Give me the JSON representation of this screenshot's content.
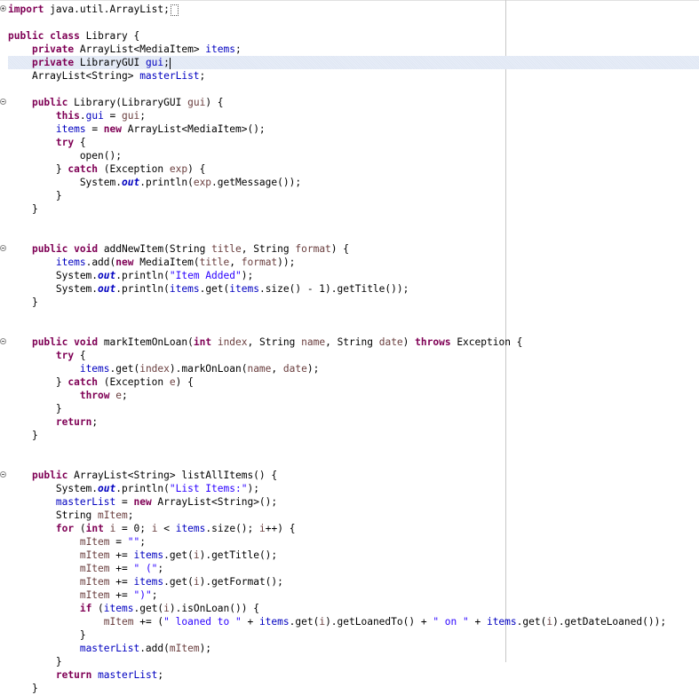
{
  "editor": {
    "language": "java",
    "lines": [
      [
        {
          "t": "import",
          "c": "k"
        },
        {
          "t": " java.util.ArrayList;"
        }
      ],
      [],
      [
        {
          "t": "public",
          "c": "k"
        },
        {
          "t": " "
        },
        {
          "t": "class",
          "c": "k"
        },
        {
          "t": " Library {"
        }
      ],
      [
        {
          "t": "    "
        },
        {
          "t": "private",
          "c": "k"
        },
        {
          "t": " ArrayList<MediaItem> "
        },
        {
          "t": "items",
          "c": "f"
        },
        {
          "t": ";"
        }
      ],
      [
        {
          "t": "    "
        },
        {
          "t": "private",
          "c": "k"
        },
        {
          "t": " LibraryGUI "
        },
        {
          "t": "gui",
          "c": "f"
        },
        {
          "t": ";"
        }
      ],
      [
        {
          "t": "    ArrayList<String> "
        },
        {
          "t": "masterList",
          "c": "f"
        },
        {
          "t": ";"
        }
      ],
      [],
      [
        {
          "t": "    "
        },
        {
          "t": "public",
          "c": "k"
        },
        {
          "t": " Library(LibraryGUI "
        },
        {
          "t": "gui",
          "c": "p"
        },
        {
          "t": ") {"
        }
      ],
      [
        {
          "t": "        "
        },
        {
          "t": "this",
          "c": "k"
        },
        {
          "t": "."
        },
        {
          "t": "gui",
          "c": "f"
        },
        {
          "t": " = "
        },
        {
          "t": "gui",
          "c": "p"
        },
        {
          "t": ";"
        }
      ],
      [
        {
          "t": "        "
        },
        {
          "t": "items",
          "c": "f"
        },
        {
          "t": " = "
        },
        {
          "t": "new",
          "c": "k"
        },
        {
          "t": " ArrayList<MediaItem>();"
        }
      ],
      [
        {
          "t": "        "
        },
        {
          "t": "try",
          "c": "k"
        },
        {
          "t": " {"
        }
      ],
      [
        {
          "t": "            open();"
        }
      ],
      [
        {
          "t": "        } "
        },
        {
          "t": "catch",
          "c": "k"
        },
        {
          "t": " (Exception "
        },
        {
          "t": "exp",
          "c": "p"
        },
        {
          "t": ") {"
        }
      ],
      [
        {
          "t": "            System."
        },
        {
          "t": "out",
          "c": "i"
        },
        {
          "t": ".println("
        },
        {
          "t": "exp",
          "c": "p"
        },
        {
          "t": ".getMessage());"
        }
      ],
      [
        {
          "t": "        }"
        }
      ],
      [
        {
          "t": "    }"
        }
      ],
      [],
      [],
      [
        {
          "t": "    "
        },
        {
          "t": "public",
          "c": "k"
        },
        {
          "t": " "
        },
        {
          "t": "void",
          "c": "k"
        },
        {
          "t": " addNewItem(String "
        },
        {
          "t": "title",
          "c": "p"
        },
        {
          "t": ", String "
        },
        {
          "t": "format",
          "c": "p"
        },
        {
          "t": ") {"
        }
      ],
      [
        {
          "t": "        "
        },
        {
          "t": "items",
          "c": "f"
        },
        {
          "t": ".add("
        },
        {
          "t": "new",
          "c": "k"
        },
        {
          "t": " MediaItem("
        },
        {
          "t": "title",
          "c": "p"
        },
        {
          "t": ", "
        },
        {
          "t": "format",
          "c": "p"
        },
        {
          "t": "));"
        }
      ],
      [
        {
          "t": "        System."
        },
        {
          "t": "out",
          "c": "i"
        },
        {
          "t": ".println("
        },
        {
          "t": "\"Item Added\"",
          "c": "s"
        },
        {
          "t": ");"
        }
      ],
      [
        {
          "t": "        System."
        },
        {
          "t": "out",
          "c": "i"
        },
        {
          "t": ".println("
        },
        {
          "t": "items",
          "c": "f"
        },
        {
          "t": ".get("
        },
        {
          "t": "items",
          "c": "f"
        },
        {
          "t": ".size() - 1).getTitle());"
        }
      ],
      [
        {
          "t": "    }"
        }
      ],
      [],
      [],
      [
        {
          "t": "    "
        },
        {
          "t": "public",
          "c": "k"
        },
        {
          "t": " "
        },
        {
          "t": "void",
          "c": "k"
        },
        {
          "t": " markItemOnLoan("
        },
        {
          "t": "int",
          "c": "k"
        },
        {
          "t": " "
        },
        {
          "t": "index",
          "c": "p"
        },
        {
          "t": ", String "
        },
        {
          "t": "name",
          "c": "p"
        },
        {
          "t": ", String "
        },
        {
          "t": "date",
          "c": "p"
        },
        {
          "t": ") "
        },
        {
          "t": "throws",
          "c": "k"
        },
        {
          "t": " Exception {"
        }
      ],
      [
        {
          "t": "        "
        },
        {
          "t": "try",
          "c": "k"
        },
        {
          "t": " {"
        }
      ],
      [
        {
          "t": "            "
        },
        {
          "t": "items",
          "c": "f"
        },
        {
          "t": ".get("
        },
        {
          "t": "index",
          "c": "p"
        },
        {
          "t": ").markOnLoan("
        },
        {
          "t": "name",
          "c": "p"
        },
        {
          "t": ", "
        },
        {
          "t": "date",
          "c": "p"
        },
        {
          "t": ");"
        }
      ],
      [
        {
          "t": "        } "
        },
        {
          "t": "catch",
          "c": "k"
        },
        {
          "t": " (Exception "
        },
        {
          "t": "e",
          "c": "p"
        },
        {
          "t": ") {"
        }
      ],
      [
        {
          "t": "            "
        },
        {
          "t": "throw",
          "c": "k"
        },
        {
          "t": " "
        },
        {
          "t": "e",
          "c": "p"
        },
        {
          "t": ";"
        }
      ],
      [
        {
          "t": "        }"
        }
      ],
      [
        {
          "t": "        "
        },
        {
          "t": "return",
          "c": "k"
        },
        {
          "t": ";"
        }
      ],
      [
        {
          "t": "    }"
        }
      ],
      [],
      [],
      [
        {
          "t": "    "
        },
        {
          "t": "public",
          "c": "k"
        },
        {
          "t": " ArrayList<String> listAllItems() {"
        }
      ],
      [
        {
          "t": "        System."
        },
        {
          "t": "out",
          "c": "i"
        },
        {
          "t": ".println("
        },
        {
          "t": "\"List Items:\"",
          "c": "s"
        },
        {
          "t": ");"
        }
      ],
      [
        {
          "t": "        "
        },
        {
          "t": "masterList",
          "c": "f"
        },
        {
          "t": " = "
        },
        {
          "t": "new",
          "c": "k"
        },
        {
          "t": " ArrayList<String>();"
        }
      ],
      [
        {
          "t": "        String "
        },
        {
          "t": "mItem",
          "c": "p"
        },
        {
          "t": ";"
        }
      ],
      [
        {
          "t": "        "
        },
        {
          "t": "for",
          "c": "k"
        },
        {
          "t": " ("
        },
        {
          "t": "int",
          "c": "k"
        },
        {
          "t": " "
        },
        {
          "t": "i",
          "c": "p"
        },
        {
          "t": " = 0; "
        },
        {
          "t": "i",
          "c": "p"
        },
        {
          "t": " < "
        },
        {
          "t": "items",
          "c": "f"
        },
        {
          "t": ".size(); "
        },
        {
          "t": "i",
          "c": "p"
        },
        {
          "t": "++) {"
        }
      ],
      [
        {
          "t": "            "
        },
        {
          "t": "mItem",
          "c": "p"
        },
        {
          "t": " = "
        },
        {
          "t": "\"\"",
          "c": "s"
        },
        {
          "t": ";"
        }
      ],
      [
        {
          "t": "            "
        },
        {
          "t": "mItem",
          "c": "p"
        },
        {
          "t": " += "
        },
        {
          "t": "items",
          "c": "f"
        },
        {
          "t": ".get("
        },
        {
          "t": "i",
          "c": "p"
        },
        {
          "t": ").getTitle();"
        }
      ],
      [
        {
          "t": "            "
        },
        {
          "t": "mItem",
          "c": "p"
        },
        {
          "t": " += "
        },
        {
          "t": "\" (\"",
          "c": "s"
        },
        {
          "t": ";"
        }
      ],
      [
        {
          "t": "            "
        },
        {
          "t": "mItem",
          "c": "p"
        },
        {
          "t": " += "
        },
        {
          "t": "items",
          "c": "f"
        },
        {
          "t": ".get("
        },
        {
          "t": "i",
          "c": "p"
        },
        {
          "t": ").getFormat();"
        }
      ],
      [
        {
          "t": "            "
        },
        {
          "t": "mItem",
          "c": "p"
        },
        {
          "t": " += "
        },
        {
          "t": "\")\"",
          "c": "s"
        },
        {
          "t": ";"
        }
      ],
      [
        {
          "t": "            "
        },
        {
          "t": "if",
          "c": "k"
        },
        {
          "t": " ("
        },
        {
          "t": "items",
          "c": "f"
        },
        {
          "t": ".get("
        },
        {
          "t": "i",
          "c": "p"
        },
        {
          "t": ").isOnLoan()) {"
        }
      ],
      [
        {
          "t": "                "
        },
        {
          "t": "mItem",
          "c": "p"
        },
        {
          "t": " += ("
        },
        {
          "t": "\" loaned to \"",
          "c": "s"
        },
        {
          "t": " + "
        },
        {
          "t": "items",
          "c": "f"
        },
        {
          "t": ".get("
        },
        {
          "t": "i",
          "c": "p"
        },
        {
          "t": ").getLoanedTo() + "
        },
        {
          "t": "\" on \"",
          "c": "s"
        },
        {
          "t": " + "
        },
        {
          "t": "items",
          "c": "f"
        },
        {
          "t": ".get("
        },
        {
          "t": "i",
          "c": "p"
        },
        {
          "t": ").getDateLoaned());"
        }
      ],
      [
        {
          "t": "            }"
        }
      ],
      [
        {
          "t": "            "
        },
        {
          "t": "masterList",
          "c": "f"
        },
        {
          "t": ".add("
        },
        {
          "t": "mItem",
          "c": "p"
        },
        {
          "t": ");"
        }
      ],
      [
        {
          "t": "        }"
        }
      ],
      [
        {
          "t": "        "
        },
        {
          "t": "return",
          "c": "k"
        },
        {
          "t": " "
        },
        {
          "t": "masterList",
          "c": "f"
        },
        {
          "t": ";"
        }
      ],
      [
        {
          "t": "    }"
        }
      ]
    ],
    "highlighted_line": 4,
    "cursor_line": 4,
    "collapsed_import_marker_line": 0,
    "fold_markers": [
      {
        "line": 0,
        "kind": "plus"
      },
      {
        "line": 7,
        "kind": "minus"
      },
      {
        "line": 18,
        "kind": "minus"
      },
      {
        "line": 25,
        "kind": "minus"
      },
      {
        "line": 35,
        "kind": "minus"
      }
    ]
  }
}
